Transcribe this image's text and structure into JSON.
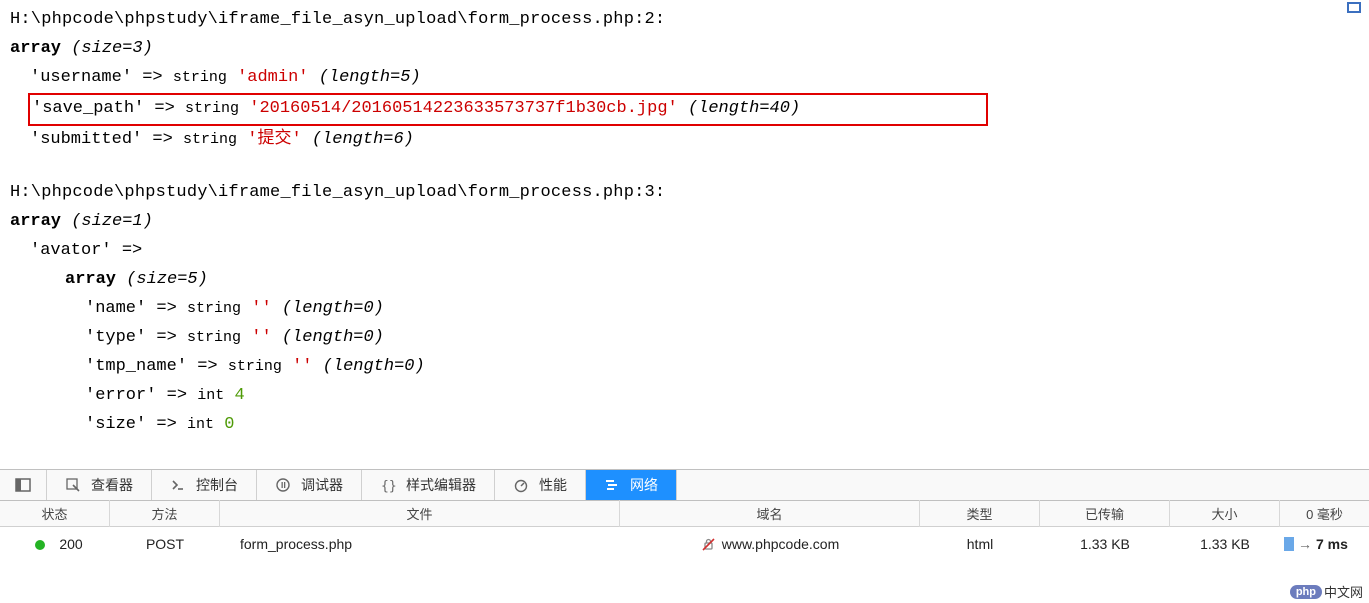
{
  "dump1": {
    "path": "H:\\phpcode\\phpstudy\\iframe_file_asyn_upload\\form_process.php:2:",
    "array_label": "array",
    "size_label": "(size=3)",
    "username": {
      "key": "'username'",
      "arrow": "=>",
      "type": "string",
      "value": "'admin'",
      "len": "(length=5)"
    },
    "save_path": {
      "key": "'save_path'",
      "arrow": "=>",
      "type": "string",
      "value": "'20160514/20160514223633573737f1b30cb.jpg'",
      "len": "(length=40)"
    },
    "submitted": {
      "key": "'submitted'",
      "arrow": "=>",
      "type": "string",
      "value": "'提交'",
      "len": "(length=6)"
    }
  },
  "dump2": {
    "path": "H:\\phpcode\\phpstudy\\iframe_file_asyn_upload\\form_process.php:3:",
    "array_label": "array",
    "size_label": "(size=1)",
    "avator_key": "'avator'",
    "avator_arrow": "=>",
    "inner_array_label": "array",
    "inner_size_label": "(size=5)",
    "name": {
      "key": "'name'",
      "arrow": "=>",
      "type": "string",
      "value": "''",
      "len": "(length=0)"
    },
    "type": {
      "key": "'type'",
      "arrow": "=>",
      "type": "string",
      "value": "''",
      "len": "(length=0)"
    },
    "tmp_name": {
      "key": "'tmp_name'",
      "arrow": "=>",
      "type": "string",
      "value": "''",
      "len": "(length=0)"
    },
    "error": {
      "key": "'error'",
      "arrow": "=>",
      "type": "int",
      "value": "4"
    },
    "sizef": {
      "key": "'size'",
      "arrow": "=>",
      "type": "int",
      "value": "0"
    }
  },
  "devtools": {
    "inspector": "查看器",
    "console": "控制台",
    "debugger": "调试器",
    "style_editor": "样式编辑器",
    "performance": "性能",
    "network": "网络"
  },
  "net_header": {
    "status": "状态",
    "method": "方法",
    "file": "文件",
    "domain": "域名",
    "type": "类型",
    "transferred": "已传输",
    "size": "大小",
    "time": "0 毫秒"
  },
  "net_row": {
    "status": "200",
    "method": "POST",
    "file": "form_process.php",
    "domain": "www.phpcode.com",
    "type": "html",
    "transferred": "1.33 KB",
    "size": "1.33 KB",
    "arrow": "→",
    "time": "7 ms"
  },
  "footer": {
    "badge": "php",
    "text": "中文网"
  }
}
